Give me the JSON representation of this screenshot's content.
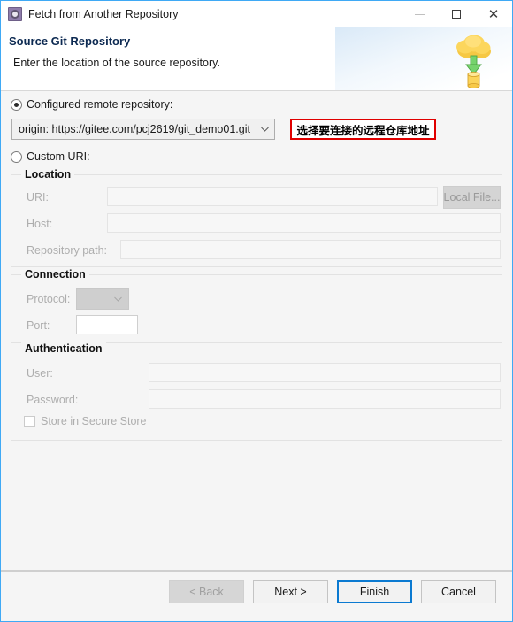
{
  "window": {
    "title": "Fetch from Another Repository",
    "app_icon": "git-repository-icon",
    "border_color": "#3fa9f5",
    "controls": {
      "minimize": "minimize-icon",
      "maximize": "maximize-icon",
      "close": "close-icon"
    }
  },
  "header": {
    "title": "Source Git Repository",
    "subtitle": "Enter the location of the source repository.",
    "graphic": "cloud-fetch-to-database-icon"
  },
  "options": {
    "configured": {
      "label": "Configured remote repository:",
      "selected": true
    },
    "custom": {
      "label": "Custom URI:",
      "selected": false
    }
  },
  "remote_combo": {
    "value": "origin: https://gitee.com/pcj2619/git_demo01.git",
    "options": [
      "origin: https://gitee.com/pcj2619/git_demo01.git"
    ],
    "chevron": "chevron-down-icon"
  },
  "annotation": {
    "text": "选择要连接的远程仓库地址",
    "border_color": "#e00000"
  },
  "location": {
    "legend": "Location",
    "uri": {
      "label": "URI:",
      "value": "",
      "placeholder": ""
    },
    "host": {
      "label": "Host:",
      "value": "",
      "placeholder": ""
    },
    "repo_path": {
      "label": "Repository path:",
      "value": "",
      "placeholder": ""
    },
    "local_file_button": "Local File..."
  },
  "connection": {
    "legend": "Connection",
    "protocol": {
      "label": "Protocol:",
      "value": "",
      "chevron": "chevron-down-icon"
    },
    "port": {
      "label": "Port:",
      "value": "",
      "placeholder": ""
    }
  },
  "authentication": {
    "legend": "Authentication",
    "user": {
      "label": "User:",
      "value": "",
      "placeholder": ""
    },
    "password": {
      "label": "Password:",
      "value": "",
      "placeholder": ""
    },
    "store_secure": {
      "label": "Store in Secure Store",
      "checked": false
    }
  },
  "footer": {
    "back": "< Back",
    "next": "Next >",
    "finish": "Finish",
    "cancel": "Cancel",
    "default_button": "Finish",
    "focus_color": "#0b7ad1"
  }
}
